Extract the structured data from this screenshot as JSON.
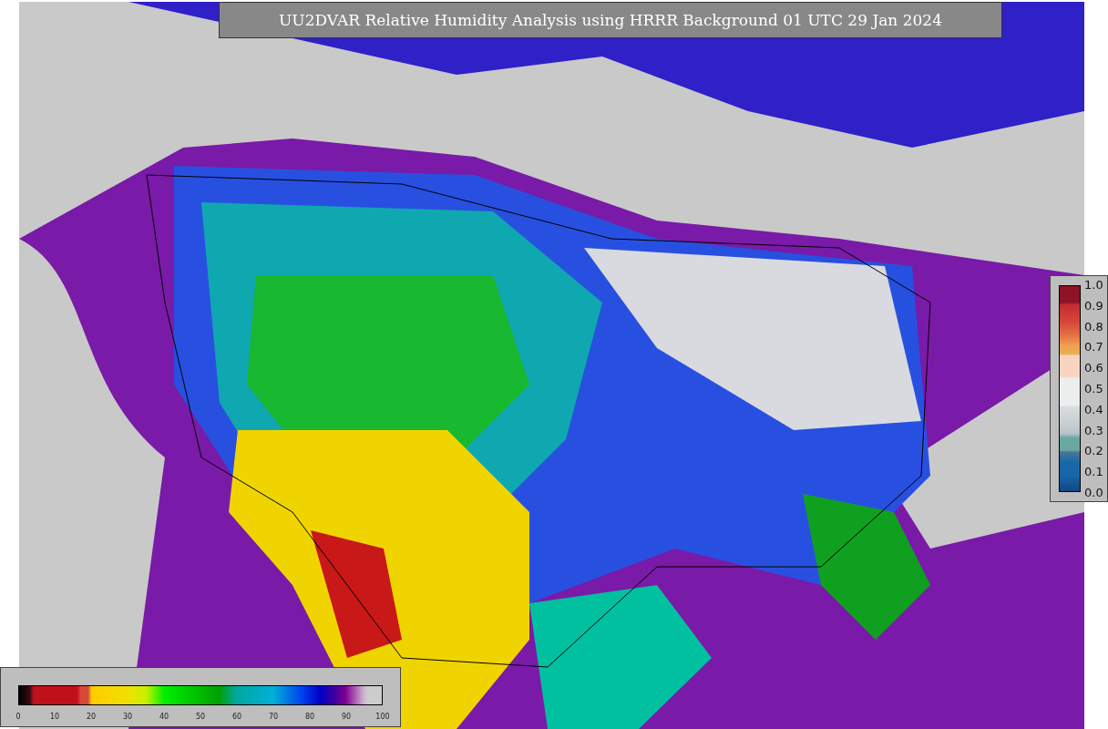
{
  "title": "UU2DVAR Relative Humidity Analysis using HRRR Background 01 UTC 29 Jan 2024",
  "humidity_colorbar": {
    "ticks": [
      "0",
      "10",
      "20",
      "30",
      "40",
      "50",
      "60",
      "70",
      "80",
      "90",
      "100"
    ]
  },
  "observation_colorbar": {
    "ticks": [
      "1.0",
      "0.9",
      "0.8",
      "0.7",
      "0.6",
      "0.5",
      "0.4",
      "0.3",
      "0.2",
      "0.1",
      "0.0"
    ]
  }
}
